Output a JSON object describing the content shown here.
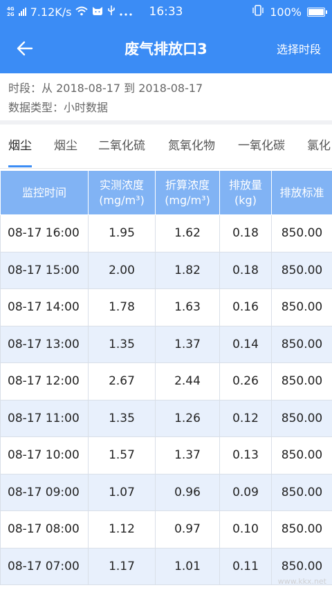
{
  "status_bar": {
    "net_top": "4G",
    "net_bottom": "2G",
    "speed": "7.12K/s",
    "time": "16:33",
    "battery": "100%"
  },
  "header": {
    "title": "废气排放口3",
    "right_action": "选择时段"
  },
  "info": {
    "period": "时段：从 2018-08-17 到 2018-08-17",
    "data_type": "数据类型：小时数据"
  },
  "tabs": [
    "烟尘",
    "烟尘",
    "二氧化硫",
    "氮氧化物",
    "一氧化碳",
    "氯化"
  ],
  "table": {
    "headers": [
      [
        "监控时间",
        ""
      ],
      [
        "实测浓度",
        "(mg/m³)"
      ],
      [
        "折算浓度",
        "(mg/m³)"
      ],
      [
        "排放量",
        "(kg)"
      ],
      [
        "排放标准",
        ""
      ]
    ],
    "rows": [
      [
        "08-17 16:00",
        "1.95",
        "1.62",
        "0.18",
        "850.00"
      ],
      [
        "08-17 15:00",
        "2.00",
        "1.82",
        "0.18",
        "850.00"
      ],
      [
        "08-17 14:00",
        "1.78",
        "1.63",
        "0.16",
        "850.00"
      ],
      [
        "08-17 13:00",
        "1.35",
        "1.37",
        "0.14",
        "850.00"
      ],
      [
        "08-17 12:00",
        "2.67",
        "2.44",
        "0.26",
        "850.00"
      ],
      [
        "08-17 11:00",
        "1.35",
        "1.26",
        "0.12",
        "850.00"
      ],
      [
        "08-17 10:00",
        "1.57",
        "1.37",
        "0.13",
        "850.00"
      ],
      [
        "08-17 09:00",
        "1.07",
        "0.96",
        "0.09",
        "850.00"
      ],
      [
        "08-17 08:00",
        "1.12",
        "0.97",
        "0.10",
        "850.00"
      ],
      [
        "08-17 07:00",
        "1.17",
        "1.01",
        "0.11",
        "850.00"
      ]
    ]
  },
  "watermark": "www.kkx.net"
}
